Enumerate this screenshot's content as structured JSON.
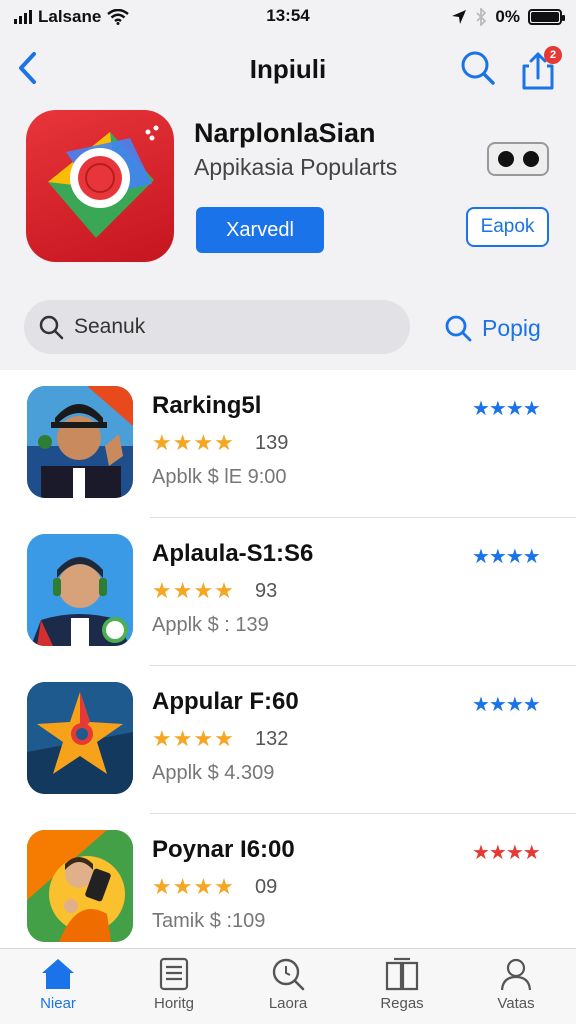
{
  "status_bar": {
    "carrier": "Lalsane",
    "time": "13:54",
    "battery": "0%"
  },
  "nav": {
    "title": "Inpiuli",
    "share_badge": "2"
  },
  "featured": {
    "name": "NarplonlaSian",
    "subtitle": "Appikasia Popularts",
    "get_label": "Xarvedl",
    "open_label": "Eapok"
  },
  "search": {
    "placeholder": "Seanuk",
    "popular_label": "Popig"
  },
  "apps": [
    {
      "name": "Rarking5l",
      "count": "139",
      "price": "Apblk $ lE 9:00",
      "rating_stars": "★★★★",
      "rating_color": "#1a73e8"
    },
    {
      "name": "Aplaula-S1:S6",
      "count": "93",
      "price": "Applk $ : 139",
      "rating_stars": "★★★★",
      "rating_color": "#1a73e8"
    },
    {
      "name": "Appular F:60",
      "count": "132",
      "price": "Applk $ 4.309",
      "rating_stars": "★★★★",
      "rating_color": "#1a73e8"
    },
    {
      "name": "Poynar I6:00",
      "count": "09",
      "price": "Tamik $ :109",
      "rating_stars": "★★★★",
      "rating_color": "#e53935"
    }
  ],
  "stars_display": "★★★★",
  "tabs": [
    {
      "label": "Niear",
      "icon": "home-icon",
      "active": true
    },
    {
      "label": "Horitg",
      "icon": "list-icon",
      "active": false
    },
    {
      "label": "Laora",
      "icon": "search-icon",
      "active": false
    },
    {
      "label": "Regas",
      "icon": "book-icon",
      "active": false
    },
    {
      "label": "Vatas",
      "icon": "profile-icon",
      "active": false
    }
  ],
  "colors": {
    "accent": "#1a73e8",
    "star": "#f5a623",
    "background": "#f2f2f4"
  }
}
